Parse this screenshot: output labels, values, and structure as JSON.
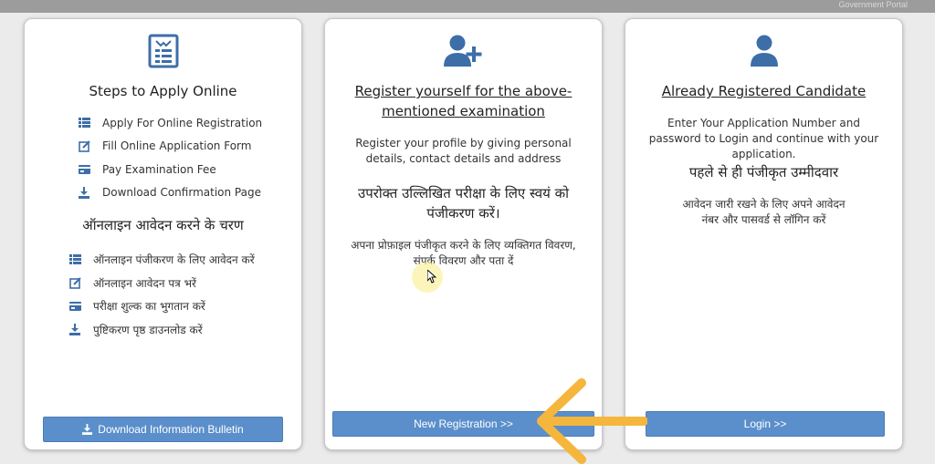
{
  "watermark": "Government Portal",
  "card1": {
    "icon": "form-list-icon",
    "title": "Steps to Apply Online",
    "steps_en": [
      {
        "icon": "list-icon",
        "label": "Apply For Online Registration"
      },
      {
        "icon": "edit-icon",
        "label": "Fill Online Application Form"
      },
      {
        "icon": "card-icon",
        "label": "Pay Examination Fee"
      },
      {
        "icon": "download-icon",
        "label": "Download Confirmation Page"
      }
    ],
    "hindi_heading": "ऑनलाइन आवेदन करने के चरण",
    "steps_hi": [
      {
        "icon": "list-icon",
        "label": "ऑनलाइन पंजीकरण के लिए आवेदन करें"
      },
      {
        "icon": "edit-icon",
        "label": "ऑनलाइन आवेदन पत्र भरें"
      },
      {
        "icon": "card-icon",
        "label": "परीक्षा शुल्क का भुगतान करें"
      },
      {
        "icon": "download-icon",
        "label": "पुष्टिकरण पृष्ठ डाउनलोड करें"
      }
    ],
    "button": "Download Information Bulletin"
  },
  "card2": {
    "icon": "user-plus-icon",
    "title": "Register yourself for the above-mentioned examination",
    "desc": "Register your profile by giving personal details, contact details and address",
    "hindi_heading": "उपरोक्त उल्लिखित परीक्षा के लिए स्वयं को पंजीकरण करें।",
    "hindi_desc": "अपना प्रोफ़ाइल पंजीकृत करने के लिए व्यक्तिगत विवरण, संपर्क विवरण और पता दें",
    "button": "New Registration >>"
  },
  "card3": {
    "icon": "user-icon",
    "title": "Already Registered Candidate",
    "desc": "Enter Your Application Number and password to Login and continue with your application.",
    "hindi_heading": "पहले से ही पंजीकृत उम्मीदवार",
    "hindi_desc": "आवेदन जारी रखने के लिए अपने आवेदन नंबर और पासवर्ड से लॉगिन करें",
    "button": "Login >>"
  },
  "colors": {
    "button": "#5b8fcb",
    "icon": "#3d6ea8",
    "arrow": "#f5b63d"
  }
}
